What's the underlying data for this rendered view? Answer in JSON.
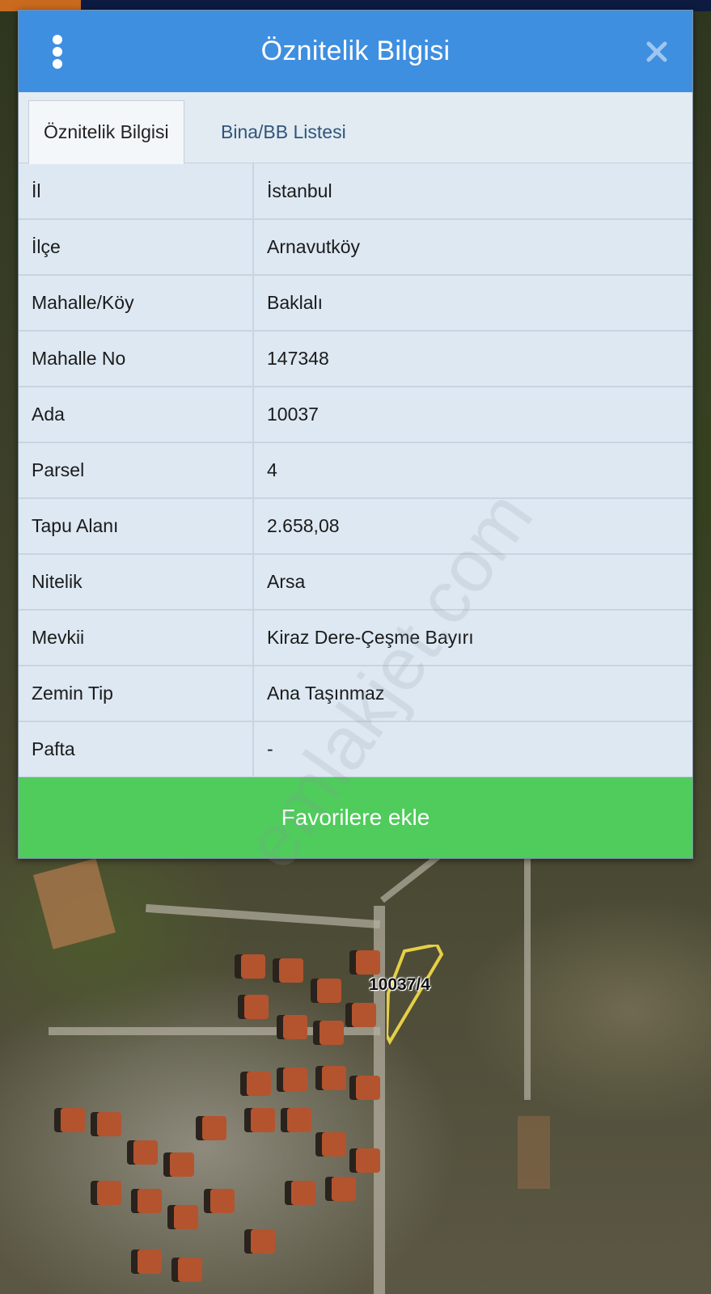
{
  "dialog": {
    "title": "Öznitelik Bilgisi",
    "menu_icon": "vertical-dots-icon",
    "close_icon": "close-icon"
  },
  "tabs": [
    {
      "label": "Öznitelik Bilgisi",
      "active": true
    },
    {
      "label": "Bina/BB Listesi",
      "active": false
    }
  ],
  "attributes": [
    {
      "key": "İl",
      "value": "İstanbul"
    },
    {
      "key": "İlçe",
      "value": "Arnavutköy"
    },
    {
      "key": "Mahalle/Köy",
      "value": "Baklalı"
    },
    {
      "key": "Mahalle No",
      "value": "147348"
    },
    {
      "key": "Ada",
      "value": "10037"
    },
    {
      "key": "Parsel",
      "value": "4"
    },
    {
      "key": "Tapu Alanı",
      "value": "2.658,08"
    },
    {
      "key": "Nitelik",
      "value": "Arsa"
    },
    {
      "key": "Mevkii",
      "value": "Kiraz Dere-Çeşme Bayırı"
    },
    {
      "key": "Zemin Tip",
      "value": "Ana Taşınmaz"
    },
    {
      "key": "Pafta",
      "value": "-"
    }
  ],
  "favorite_button": "Favorilere ekle",
  "watermark": "emlakjet.com",
  "map": {
    "parcel_label": "10037/4"
  },
  "colors": {
    "header": "#3f8fe0",
    "favorite": "#4fcc5b",
    "parcel_outline": "#e6cf47"
  }
}
